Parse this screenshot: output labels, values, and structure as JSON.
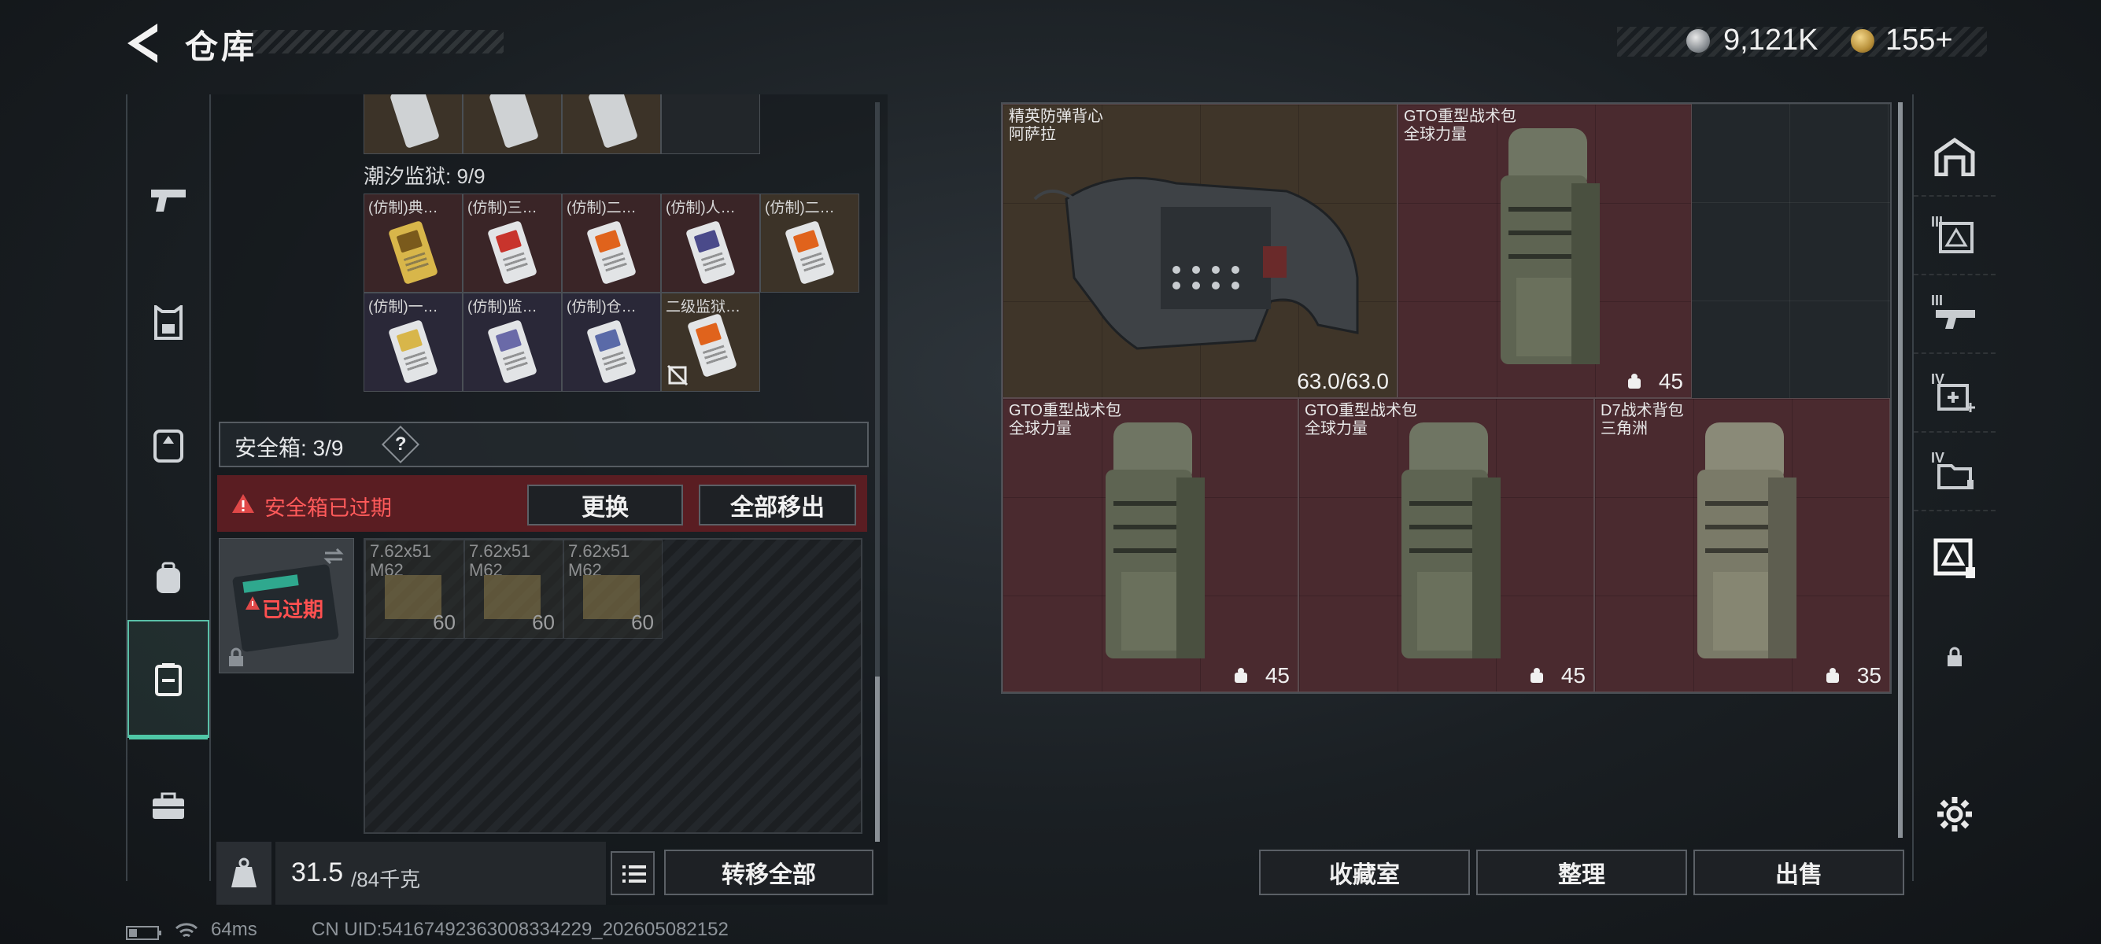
{
  "header": {
    "title": "仓库",
    "currency1": "9,121K",
    "currency2": "155+"
  },
  "nav": {
    "icons": [
      "gun-icon",
      "armor-icon",
      "vest-icon",
      "backpack-icon",
      "safe-case-icon",
      "toolbox-icon"
    ],
    "active_index": 4
  },
  "prison": {
    "title": "潮汐监狱: 9/9",
    "items": [
      {
        "label": "(仿制)典…",
        "tier": "gold"
      },
      {
        "label": "(仿制)三…",
        "tier": "red"
      },
      {
        "label": "(仿制)二…",
        "tier": "red"
      },
      {
        "label": "(仿制)人…",
        "tier": "red"
      },
      {
        "label": "(仿制)二…",
        "tier": "gold"
      },
      {
        "label": "(仿制)一…",
        "tier": "purple"
      },
      {
        "label": "(仿制)监…",
        "tier": "purple"
      },
      {
        "label": "(仿制)仓…",
        "tier": "purple"
      },
      {
        "label": "二级监狱…",
        "tier": "gold"
      }
    ]
  },
  "safebox": {
    "title": "安全箱: 3/9",
    "help": "?",
    "warning": "安全箱已过期",
    "replace_btn": "更换",
    "move_all_btn": "全部移出",
    "expired_label": "已过期",
    "ammo": [
      {
        "name": "7.62x51 M62",
        "count": "60"
      },
      {
        "name": "7.62x51 M62",
        "count": "60"
      },
      {
        "name": "7.62x51 M62",
        "count": "60"
      }
    ]
  },
  "weight": {
    "current": "31.5",
    "max": "/84千克"
  },
  "transfer_all_btn": "转移全部",
  "stash": {
    "items": [
      {
        "line1": "精英防弹背心",
        "line2": "阿萨拉",
        "value": "63.0/63.0",
        "tier": "gold"
      },
      {
        "line1": "GTO重型战术包",
        "line2": "全球力量",
        "value": "45",
        "tier": "red"
      },
      {
        "line1": "GTO重型战术包",
        "line2": "全球力量",
        "value": "45",
        "tier": "red"
      },
      {
        "line1": "GTO重型战术包",
        "line2": "全球力量",
        "value": "45",
        "tier": "red"
      },
      {
        "line1": "D7战术背包",
        "line2": "三角洲",
        "value": "35",
        "tier": "red"
      }
    ]
  },
  "right_tabs": [
    "III",
    "III",
    "IV",
    "IV"
  ],
  "buttons": {
    "collection": "收藏室",
    "organize": "整理",
    "sell": "出售"
  },
  "status": {
    "ping": "64ms",
    "uid": "CN UID:54167492363008334229_202605082152"
  },
  "colors": {
    "accent": "#4fc7a6",
    "warning": "#e04848",
    "red_tier": "#4a2a2f",
    "gold_tier": "#3f3529"
  }
}
